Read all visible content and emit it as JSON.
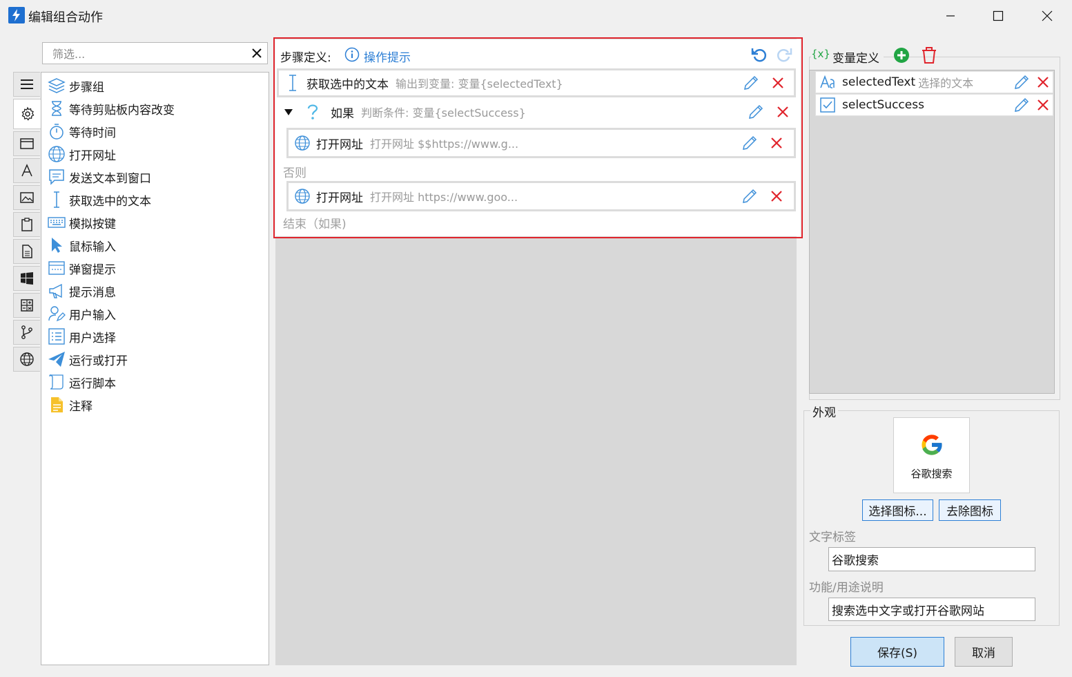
{
  "window": {
    "title": "编辑组合动作"
  },
  "filter": {
    "placeholder": "筛选..."
  },
  "actions": [
    {
      "label": "步骤组",
      "icon": "layers-icon"
    },
    {
      "label": "等待剪贴板内容改变",
      "icon": "hourglass-icon"
    },
    {
      "label": "等待时间",
      "icon": "stopwatch-icon"
    },
    {
      "label": "打开网址",
      "icon": "globe-icon"
    },
    {
      "label": "发送文本到窗口",
      "icon": "message-icon"
    },
    {
      "label": "获取选中的文本",
      "icon": "text-cursor-icon"
    },
    {
      "label": "模拟按键",
      "icon": "keyboard-icon"
    },
    {
      "label": "鼠标输入",
      "icon": "mouse-pointer-icon"
    },
    {
      "label": "弹窗提示",
      "icon": "popup-window-icon"
    },
    {
      "label": "提示消息",
      "icon": "megaphone-icon"
    },
    {
      "label": "用户输入",
      "icon": "user-edit-icon"
    },
    {
      "label": "用户选择",
      "icon": "checklist-icon"
    },
    {
      "label": "运行或打开",
      "icon": "paper-plane-icon"
    },
    {
      "label": "运行脚本",
      "icon": "script-icon"
    },
    {
      "label": "注释",
      "icon": "note-icon"
    }
  ],
  "steps": {
    "header_label": "步骤定义:",
    "hint_link": "操作提示",
    "items": [
      {
        "name": "获取选中的文本",
        "desc": "输出到变量:  变量{selectedText}"
      },
      {
        "name": "如果",
        "desc": "判断条件:  变量{selectSuccess}"
      },
      {
        "name": "打开网址",
        "desc": "打开网址 $$https://www.g..."
      },
      {
        "name": "打开网址",
        "desc": "打开网址 https://www.goo..."
      }
    ],
    "else_label": "否则",
    "end_label": "结束（如果)"
  },
  "variables": {
    "header_icon_text": "{x}",
    "header_label": "变量定义",
    "items": [
      {
        "name": "selectedText",
        "desc": "选择的文本",
        "icon": "text-variable-icon"
      },
      {
        "name": "selectSuccess",
        "desc": "",
        "icon": "checkbox-checked-icon"
      }
    ]
  },
  "appearance": {
    "group_label": "外观",
    "icon_caption": "谷歌搜索",
    "choose_icon_button": "选择图标...",
    "remove_icon_button": "去除图标",
    "text_label_caption": "文字标签",
    "text_label_value": "谷歌搜索",
    "desc_caption": "功能/用途说明",
    "desc_value": "搜索选中文字或打开谷歌网站"
  },
  "footer": {
    "save_button": "保存(S)",
    "cancel_button": "取消"
  },
  "colors": {
    "accent_blue": "#2d7fd5",
    "delete_red": "#e0242c",
    "add_green": "#21a544",
    "red_frame": "#e0242c"
  }
}
